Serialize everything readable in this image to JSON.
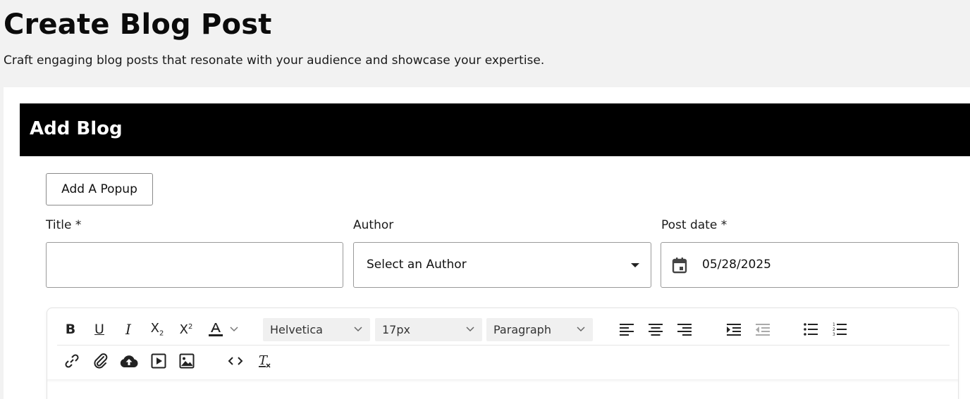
{
  "page": {
    "title": "Create Blog Post",
    "subtitle": "Craft engaging blog posts that resonate with your audience and showcase your expertise."
  },
  "card": {
    "header": "Add Blog",
    "popup_button": "Add A Popup"
  },
  "form": {
    "title_label": "Title *",
    "title_value": "",
    "author_label": "Author",
    "author_value": "Select an Author",
    "post_date_label": "Post date *",
    "post_date_value": "05/28/2025"
  },
  "editor": {
    "font_family": "Helvetica",
    "font_size": "17px",
    "block_format": "Paragraph",
    "toolbar_row1": [
      "bold-icon",
      "underline-icon",
      "italic-icon",
      "subscript-icon",
      "superscript-icon",
      "text-color-icon",
      "align-left-icon",
      "align-center-icon",
      "align-right-icon",
      "indent-icon",
      "outdent-icon",
      "bullet-list-icon",
      "numbered-list-icon"
    ],
    "toolbar_row2": [
      "link-icon",
      "attachment-icon",
      "cloud-upload-icon",
      "video-icon",
      "image-icon",
      "code-icon",
      "clear-format-icon"
    ]
  },
  "colors": {
    "header_bg": "#000000",
    "page_bg": "#f2f2f2",
    "card_bg": "#ffffff"
  }
}
